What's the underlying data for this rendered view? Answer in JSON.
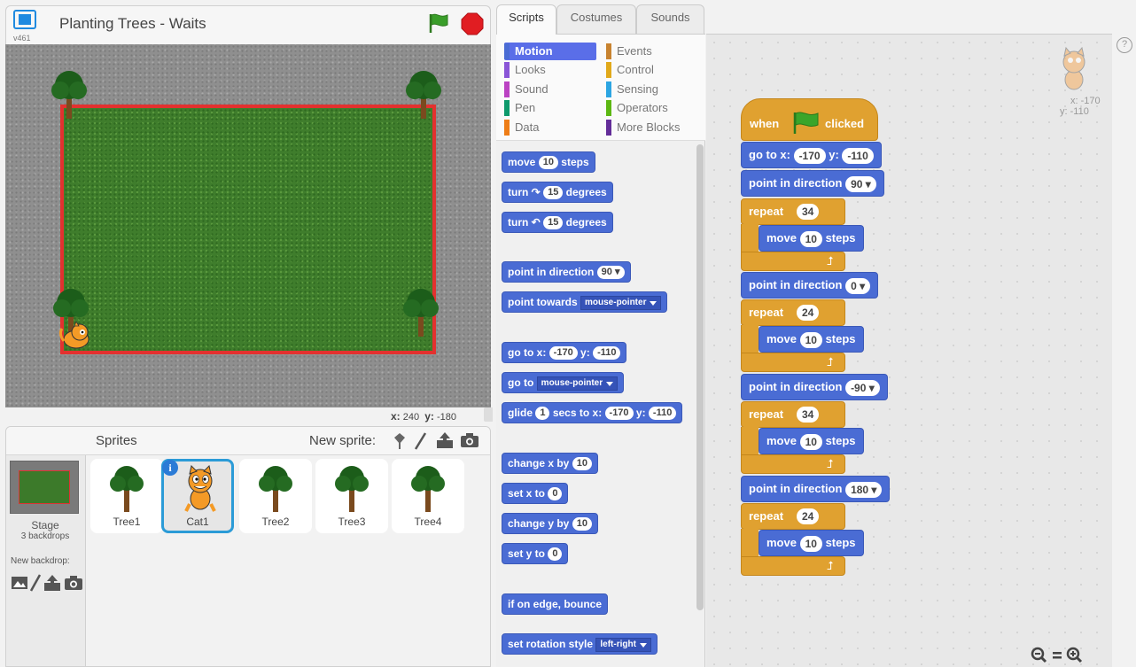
{
  "stage": {
    "title": "Planting Trees - Waits",
    "version": "v461",
    "coords_x_label": "x:",
    "coords_x": "240",
    "coords_y_label": "y:",
    "coords_y": "-180"
  },
  "sprites": {
    "title": "Sprites",
    "new_sprite_label": "New sprite:",
    "stage_label": "Stage",
    "stage_backdrops": "3 backdrops",
    "new_backdrop_label": "New backdrop:",
    "items": [
      {
        "name": "Tree1",
        "icon": "tree-icon"
      },
      {
        "name": "Cat1",
        "icon": "cat-icon",
        "selected": true
      },
      {
        "name": "Tree2",
        "icon": "tree-icon"
      },
      {
        "name": "Tree3",
        "icon": "tree-icon"
      },
      {
        "name": "Tree4",
        "icon": "tree-icon"
      }
    ]
  },
  "tabs": [
    "Scripts",
    "Costumes",
    "Sounds"
  ],
  "categories": {
    "left": [
      {
        "label": "Motion",
        "color": "#4a6cd4",
        "selected": true
      },
      {
        "label": "Looks",
        "color": "#8a55d7"
      },
      {
        "label": "Sound",
        "color": "#bb42c3"
      },
      {
        "label": "Pen",
        "color": "#0e9a6c"
      },
      {
        "label": "Data",
        "color": "#ee7d16"
      }
    ],
    "right": [
      {
        "label": "Events",
        "color": "#c88330"
      },
      {
        "label": "Control",
        "color": "#e1a91a"
      },
      {
        "label": "Sensing",
        "color": "#2ca5e2"
      },
      {
        "label": "Operators",
        "color": "#5cb712"
      },
      {
        "label": "More Blocks",
        "color": "#632d99"
      }
    ]
  },
  "palette": {
    "move": [
      "move",
      "10",
      "steps"
    ],
    "turn_right": [
      "turn",
      "15",
      "degrees"
    ],
    "turn_left": [
      "turn",
      "15",
      "degrees"
    ],
    "point_dir": [
      "point in direction",
      "90"
    ],
    "point_towards": [
      "point towards",
      "mouse-pointer"
    ],
    "goto_xy": [
      "go to x:",
      "-170",
      "y:",
      "-110"
    ],
    "goto": [
      "go to",
      "mouse-pointer"
    ],
    "glide": [
      "glide",
      "1",
      "secs to x:",
      "-170",
      "y:",
      "-110"
    ],
    "change_x": [
      "change x by",
      "10"
    ],
    "set_x": [
      "set x to",
      "0"
    ],
    "change_y": [
      "change y by",
      "10"
    ],
    "set_y": [
      "set y to",
      "0"
    ],
    "bounce": "if on edge, bounce",
    "rotation": [
      "set rotation style",
      "left-right"
    ]
  },
  "script": {
    "hat": [
      "when",
      "clicked"
    ],
    "goto": [
      "go to x:",
      "-170",
      "y:",
      "-110"
    ],
    "dir1": [
      "point in direction",
      "90"
    ],
    "rep1": [
      "repeat",
      "34"
    ],
    "move1": [
      "move",
      "10",
      "steps"
    ],
    "dir2": [
      "point in direction",
      "0"
    ],
    "rep2": [
      "repeat",
      "24"
    ],
    "move2": [
      "move",
      "10",
      "steps"
    ],
    "dir3": [
      "point in direction",
      "-90"
    ],
    "rep3": [
      "repeat",
      "34"
    ],
    "move3": [
      "move",
      "10",
      "steps"
    ],
    "dir4": [
      "point in direction",
      "180"
    ],
    "rep4": [
      "repeat",
      "24"
    ],
    "move4": [
      "move",
      "10",
      "steps"
    ]
  },
  "corner": {
    "x": "x: -170",
    "y": "y: -110"
  },
  "help": "?",
  "colors": {
    "motion": "#4a6cd4",
    "control": "#e0a130",
    "events": "#e0a130",
    "stage_border": "#e3312f",
    "selected_sprite": "#2b9bd7"
  }
}
